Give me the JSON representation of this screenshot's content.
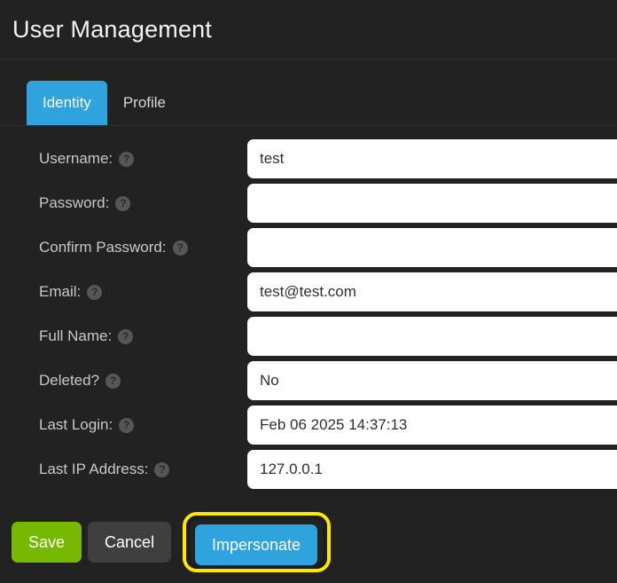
{
  "header": {
    "title": "User Management"
  },
  "tabs": [
    {
      "label": "Identity",
      "active": true
    },
    {
      "label": "Profile",
      "active": false
    }
  ],
  "help_icon_glyph": "?",
  "help_icon_name": "question-mark-help-icon",
  "form": {
    "fields": [
      {
        "label": "Username:",
        "value": "test",
        "placeholder": "",
        "name": "username"
      },
      {
        "label": "Password:",
        "value": "",
        "placeholder": "",
        "name": "password"
      },
      {
        "label": "Confirm Password:",
        "value": "",
        "placeholder": "",
        "name": "confirm-password"
      },
      {
        "label": "Email:",
        "value": "test@test.com",
        "placeholder": "",
        "name": "email"
      },
      {
        "label": "Full Name:",
        "value": "",
        "placeholder": "",
        "name": "full-name"
      },
      {
        "label": "Deleted?",
        "value": "No",
        "placeholder": "",
        "name": "deleted"
      },
      {
        "label": "Last Login:",
        "value": "Feb 06 2025 14:37:13",
        "placeholder": "",
        "name": "last-login"
      },
      {
        "label": "Last IP Address:",
        "value": "127.0.0.1",
        "placeholder": "",
        "name": "last-ip-address"
      }
    ]
  },
  "buttons": {
    "save": "Save",
    "cancel": "Cancel",
    "impersonate": "Impersonate"
  },
  "colors": {
    "background": "#222222",
    "accent_blue": "#2ea3dd",
    "save_green": "#76b900",
    "cancel_gray": "#3f3f3f",
    "highlight_yellow": "#ffe800",
    "input_white": "#ffffff",
    "label_text": "#c8c8c8"
  }
}
